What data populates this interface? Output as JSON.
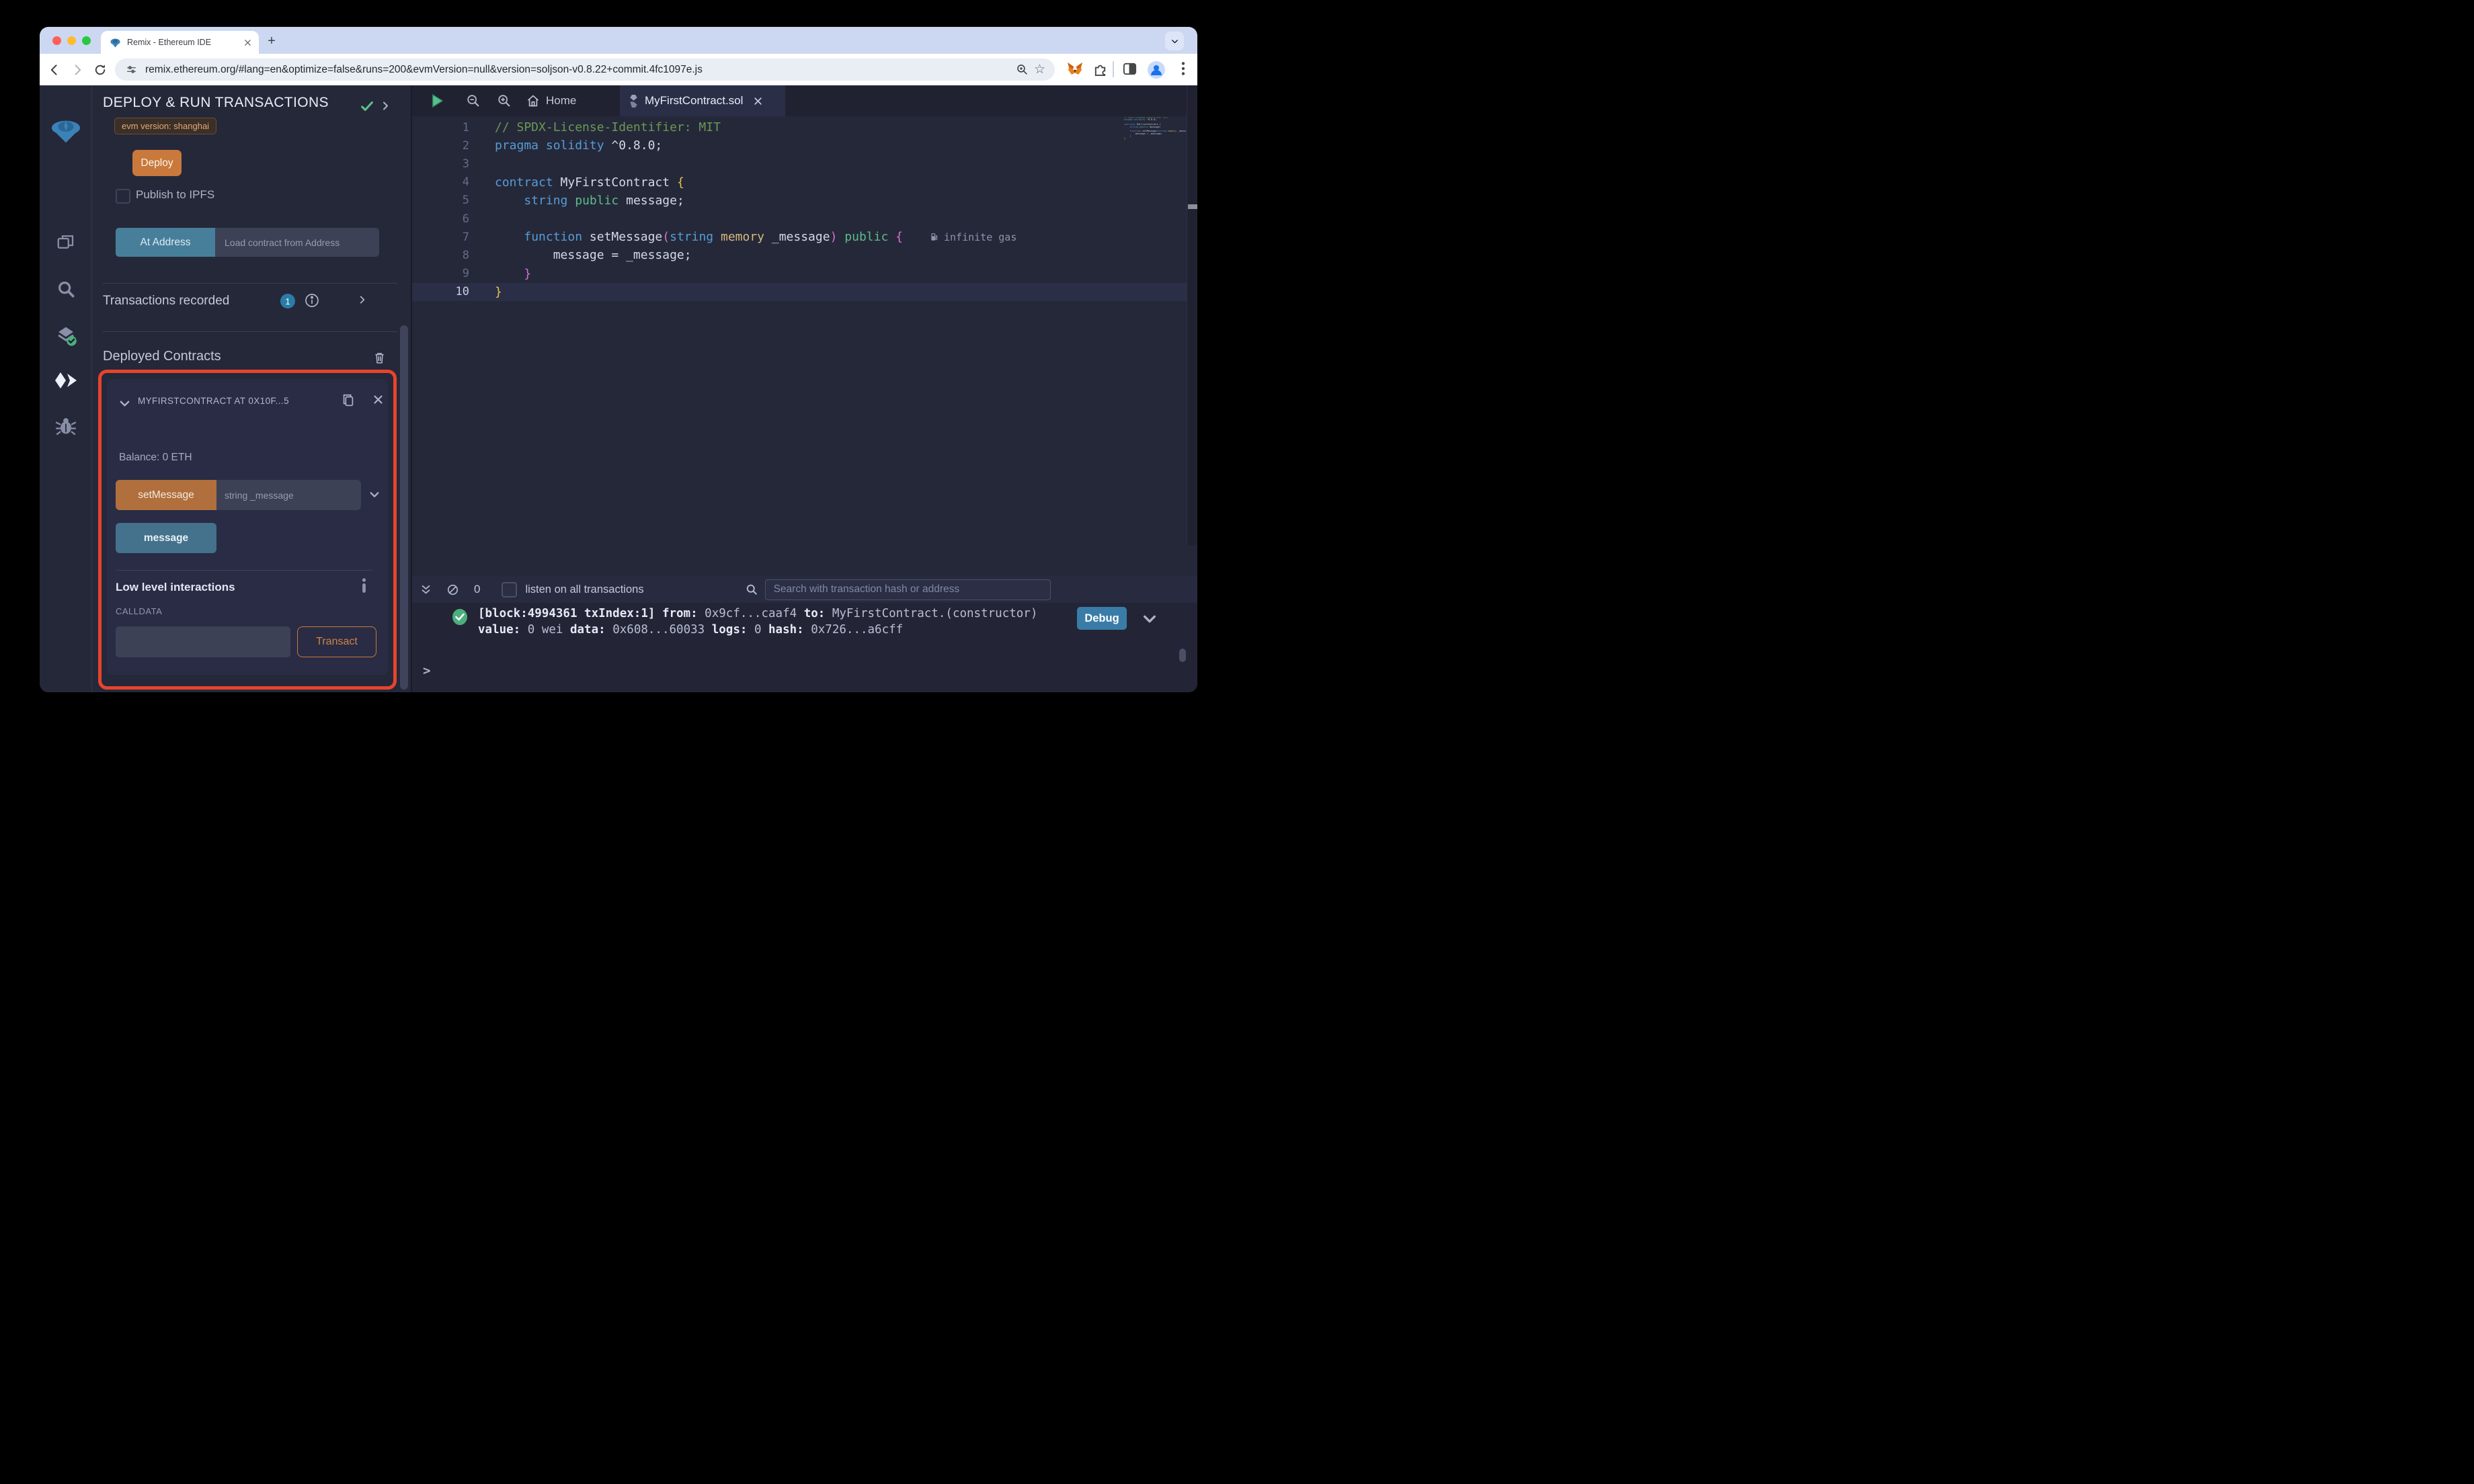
{
  "browser": {
    "tab_title": "Remix - Ethereum IDE",
    "url": "remix.ethereum.org/#lang=en&optimize=false&runs=200&evmVersion=null&version=soljson-v0.8.22+commit.4fc1097e.js"
  },
  "side_panel": {
    "title": "DEPLOY & RUN TRANSACTIONS",
    "evm_badge": "evm version: shanghai",
    "deploy_label": "Deploy",
    "publish_label": "Publish to IPFS",
    "at_address_label": "At Address",
    "at_address_placeholder": "Load contract from Address",
    "tx_recorded_label": "Transactions recorded",
    "tx_recorded_count": "1",
    "deployed_title": "Deployed Contracts",
    "contract": {
      "header": "MYFIRSTCONTRACT AT 0X10F...5",
      "balance": "Balance: 0 ETH",
      "set_message_label": "setMessage",
      "set_message_placeholder": "string _message",
      "message_label": "message",
      "low_level_title": "Low level interactions",
      "calldata_label": "CALLDATA",
      "transact_label": "Transact"
    }
  },
  "editor": {
    "home_tab": "Home",
    "file_tab": "MyFirstContract.sol",
    "gas_note": "infinite gas",
    "active_line": 10,
    "lines": [
      {
        "n": 1,
        "seg": [
          [
            "cm",
            "// SPDX-License-Identifier: MIT"
          ]
        ]
      },
      {
        "n": 2,
        "seg": [
          [
            "kw",
            "pragma"
          ],
          [
            "tx",
            " "
          ],
          [
            "kw",
            "solidity"
          ],
          [
            "tx",
            " ^0.8.0;"
          ]
        ]
      },
      {
        "n": 3,
        "seg": []
      },
      {
        "n": 4,
        "seg": [
          [
            "kw",
            "contract"
          ],
          [
            "tx",
            " MyFirstContract "
          ],
          [
            "b1",
            "{"
          ]
        ]
      },
      {
        "n": 5,
        "seg": [
          [
            "tx",
            "    "
          ],
          [
            "kw",
            "string"
          ],
          [
            "tx",
            " "
          ],
          [
            "vis",
            "public"
          ],
          [
            "tx",
            " message;"
          ]
        ]
      },
      {
        "n": 6,
        "seg": []
      },
      {
        "n": 7,
        "gas": true,
        "seg": [
          [
            "tx",
            "    "
          ],
          [
            "kw",
            "function"
          ],
          [
            "tx",
            " setMessage"
          ],
          [
            "b2",
            "("
          ],
          [
            "kw",
            "string"
          ],
          [
            "tx",
            " "
          ],
          [
            "mod",
            "memory"
          ],
          [
            "tx",
            " _message"
          ],
          [
            "b2",
            ")"
          ],
          [
            "tx",
            " "
          ],
          [
            "vis",
            "public"
          ],
          [
            "tx",
            " "
          ],
          [
            "b2",
            "{"
          ]
        ]
      },
      {
        "n": 8,
        "seg": [
          [
            "tx",
            "        message = _message;"
          ]
        ]
      },
      {
        "n": 9,
        "seg": [
          [
            "tx",
            "    "
          ],
          [
            "b2",
            "}"
          ]
        ]
      },
      {
        "n": 10,
        "seg": [
          [
            "b1",
            "}"
          ]
        ]
      }
    ]
  },
  "terminal": {
    "count": "0",
    "listen_label": "listen on all transactions",
    "search_placeholder": "Search with transaction hash or address",
    "debug_label": "Debug",
    "prompt": ">",
    "log": [
      [
        [
          "b",
          "[block:4994361 txIndex:1]"
        ],
        [
          "n",
          "  "
        ],
        [
          "b",
          "from:"
        ],
        [
          "n",
          " 0x9cf...caaf4 "
        ],
        [
          "b",
          "to:"
        ],
        [
          "n",
          " MyFirstContract.(constructor)"
        ]
      ],
      [
        [
          "b",
          "value:"
        ],
        [
          "n",
          " 0 wei "
        ],
        [
          "b",
          "data:"
        ],
        [
          "n",
          " 0x608...60033 "
        ],
        [
          "b",
          "logs:"
        ],
        [
          "n",
          " 0 "
        ],
        [
          "b",
          "hash:"
        ],
        [
          "n",
          " 0x726...a6cff"
        ]
      ]
    ]
  },
  "colors": {
    "accent_orange": "#C9793B",
    "steel_blue": "#477F9B",
    "debug_blue": "#3A7CA8",
    "highlight_red": "#E8432D",
    "success_green": "#5CC08B"
  }
}
